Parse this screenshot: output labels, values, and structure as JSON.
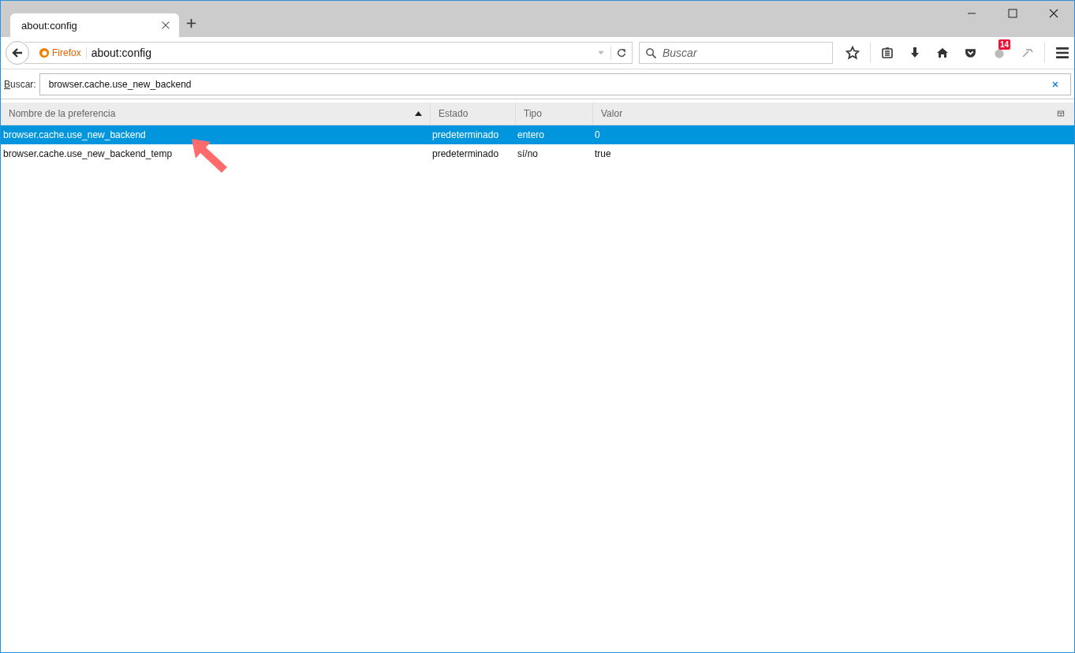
{
  "tabs": [
    {
      "title": "about:config",
      "selected": true
    }
  ],
  "address_bar": {
    "identity_label": "Firefox",
    "url": "about:config"
  },
  "search_field": {
    "placeholder": "Buscar"
  },
  "toolbar": {
    "notification_badge": "14"
  },
  "filter": {
    "label": "Buscar:",
    "value": "browser.cache.use_new_backend"
  },
  "table": {
    "columns": [
      {
        "label": "Nombre de la preferencia",
        "sorted": true
      },
      {
        "label": "Estado",
        "sorted": false
      },
      {
        "label": "Tipo",
        "sorted": false
      },
      {
        "label": "Valor",
        "sorted": false
      }
    ],
    "rows": [
      {
        "name": "browser.cache.use_new_backend",
        "status": "predeterminado",
        "type": "entero",
        "value": "0",
        "selected": true
      },
      {
        "name": "browser.cache.use_new_backend_temp",
        "status": "predeterminado",
        "type": "sí/no",
        "value": "true",
        "selected": false
      }
    ]
  }
}
